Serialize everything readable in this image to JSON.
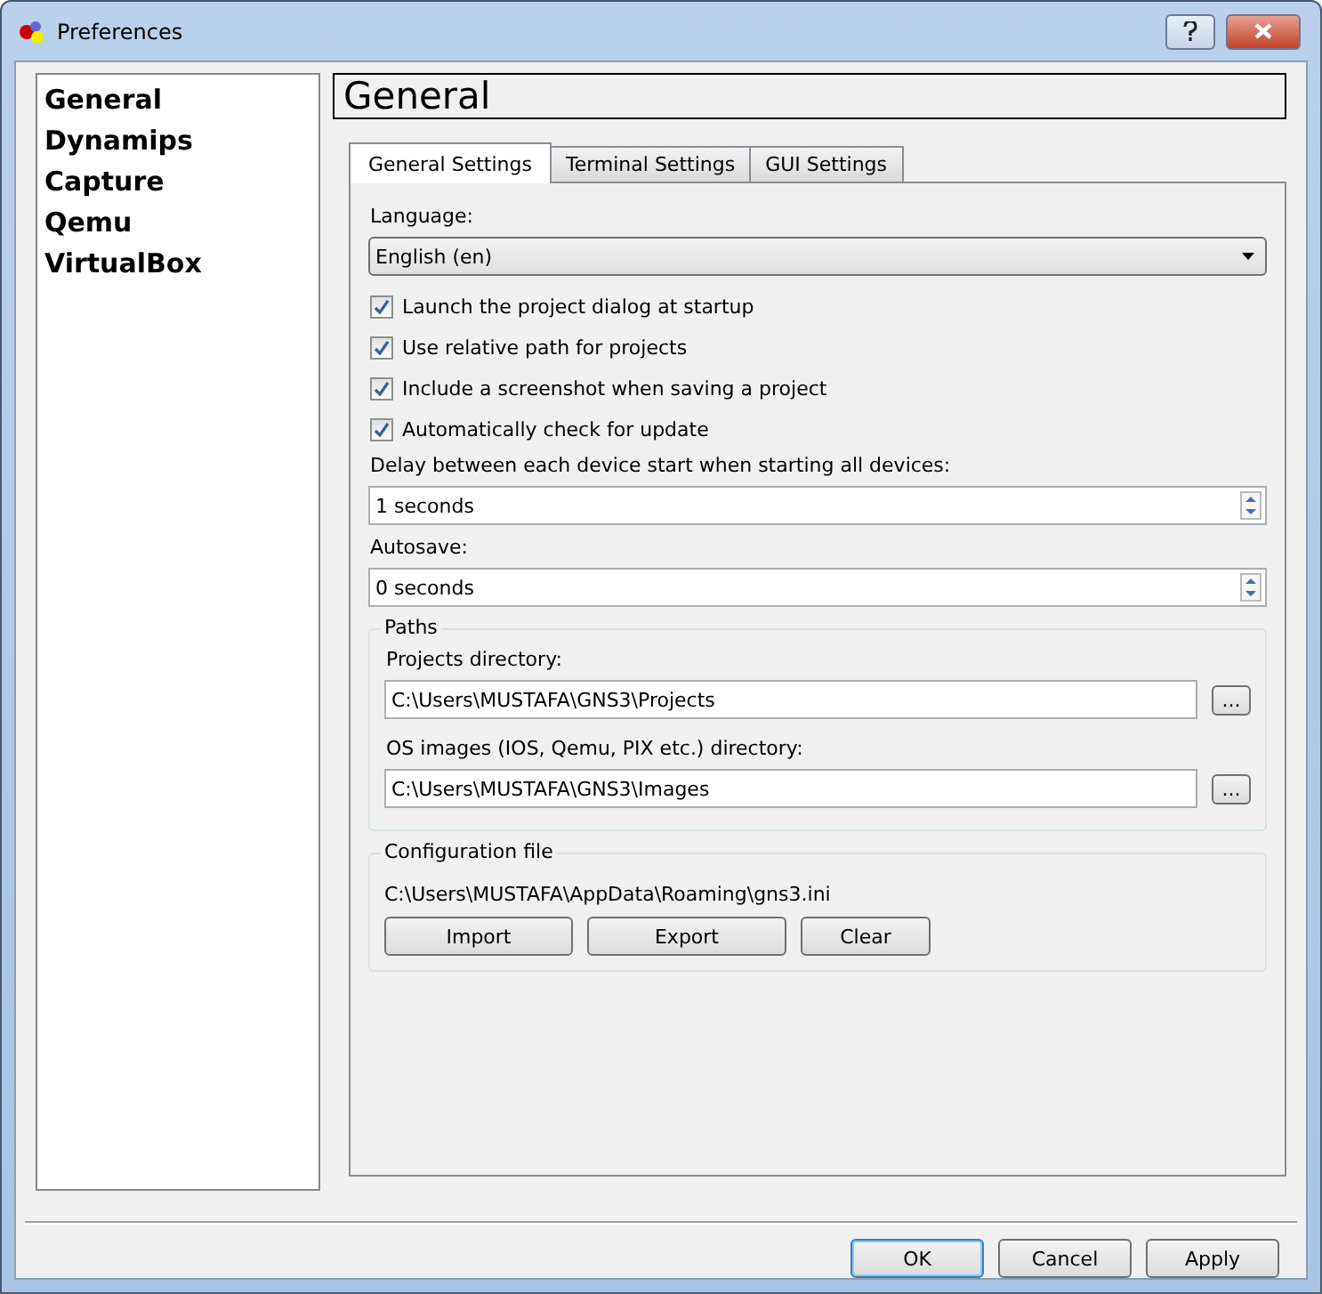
{
  "window": {
    "title": "Preferences"
  },
  "sidebar": {
    "items": [
      {
        "label": "General",
        "selected": false
      },
      {
        "label": "Dynamips",
        "selected": false
      },
      {
        "label": "Capture",
        "selected": false
      },
      {
        "label": "Qemu",
        "selected": false
      },
      {
        "label": "VirtualBox",
        "selected": false
      }
    ]
  },
  "page_title": "General",
  "tabs": [
    {
      "label": "General Settings",
      "selected": true
    },
    {
      "label": "Terminal Settings",
      "selected": false
    },
    {
      "label": "GUI Settings",
      "selected": false
    }
  ],
  "language": {
    "label": "Language:",
    "value": "English (en)"
  },
  "checkboxes": [
    {
      "label": "Launch the project dialog at startup",
      "checked": true
    },
    {
      "label": "Use relative path for projects",
      "checked": true
    },
    {
      "label": "Include a screenshot when saving a project",
      "checked": true
    },
    {
      "label": "Automatically check for update",
      "checked": true
    }
  ],
  "delay": {
    "label": "Delay between each device start when starting all devices:",
    "value": "1 seconds"
  },
  "autosave": {
    "label": "Autosave:",
    "value": "0 seconds"
  },
  "paths": {
    "title": "Paths",
    "fields": [
      {
        "label": "Projects directory:",
        "value": "C:\\Users\\MUSTAFA\\GNS3\\Projects",
        "browse": "..."
      },
      {
        "label": "OS images (IOS, Qemu, PIX etc.) directory:",
        "value": "C:\\Users\\MUSTAFA\\GNS3\\Images",
        "browse": "..."
      }
    ]
  },
  "config": {
    "title": "Configuration file",
    "path": "C:\\Users\\MUSTAFA\\AppData\\Roaming\\gns3.ini",
    "buttons": [
      "Import",
      "Export",
      "Clear"
    ]
  },
  "buttons": [
    {
      "label": "OK",
      "default": true
    },
    {
      "label": "Cancel",
      "default": false
    },
    {
      "label": "Apply",
      "default": false
    }
  ]
}
